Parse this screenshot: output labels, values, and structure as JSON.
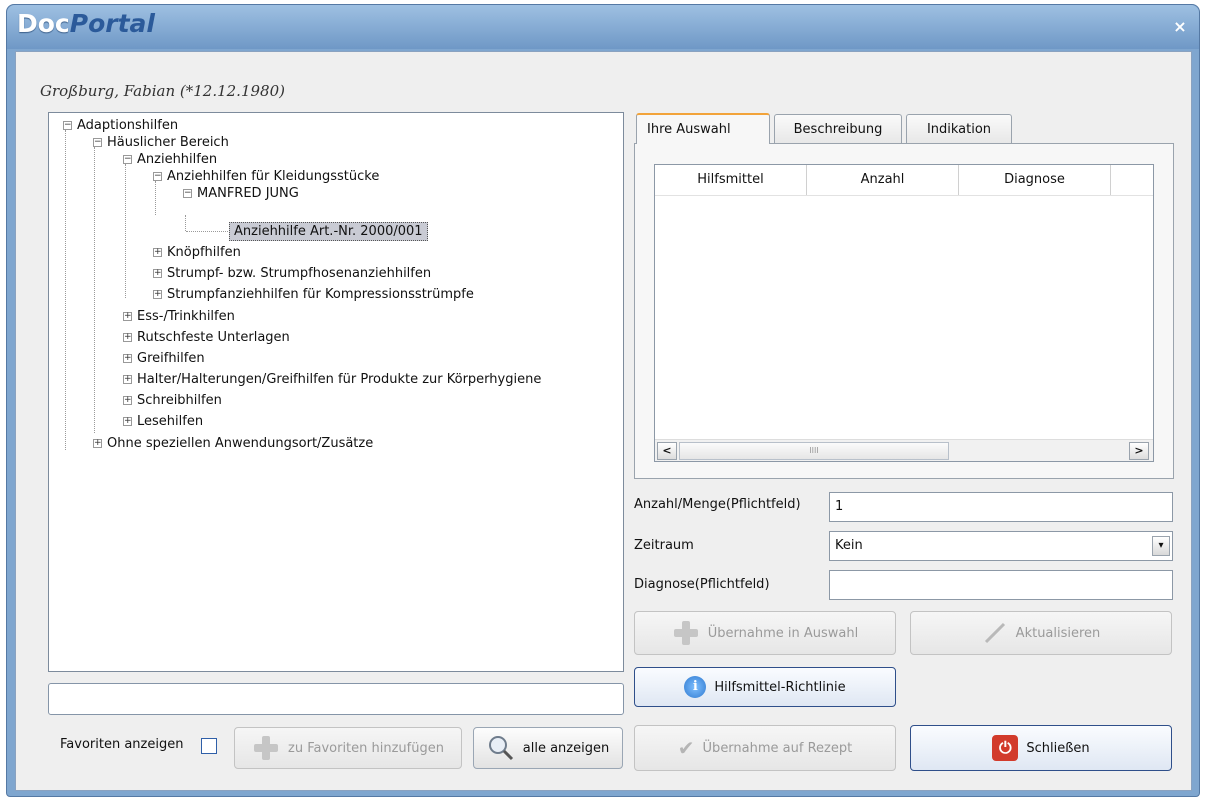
{
  "window": {
    "title_part1": "Doc",
    "title_part2": "Portal",
    "close_glyph": "×"
  },
  "patient": "Großburg, Fabian (*12.12.1980)",
  "tree": [
    {
      "label": "Adaptionshilfen",
      "toggle": "−"
    },
    {
      "label": "Häuslicher Bereich",
      "toggle": "−"
    },
    {
      "label": "Anziehhilfen",
      "toggle": "−"
    },
    {
      "label": "Anziehhilfen für Kleidungsstücke",
      "toggle": "−"
    },
    {
      "label": "MANFRED JUNG",
      "toggle": "−"
    },
    {
      "label": "Anziehhilfe Art.-Nr. 2000/001",
      "selected": true
    },
    {
      "label": "Knöpfhilfen",
      "toggle": "+"
    },
    {
      "label": "Strumpf- bzw. Strumpfhosenanziehhilfen",
      "toggle": "+"
    },
    {
      "label": "Strumpfanziehhilfen für Kompressionsstrümpfe",
      "toggle": "+"
    },
    {
      "label": "Ess-/Trinkhilfen",
      "toggle": "+"
    },
    {
      "label": "Rutschfeste Unterlagen",
      "toggle": "+"
    },
    {
      "label": "Greifhilfen",
      "toggle": "+"
    },
    {
      "label": "Halter/Halterungen/Greifhilfen für Produkte zur Körperhygiene",
      "toggle": "+"
    },
    {
      "label": "Schreibhilfen",
      "toggle": "+"
    },
    {
      "label": "Lesehilfen",
      "toggle": "+"
    },
    {
      "label": "Ohne speziellen Anwendungsort/Zusätze",
      "toggle": "+"
    }
  ],
  "tabs": [
    "Ihre Auswahl",
    "Beschreibung",
    "Indikation"
  ],
  "grid": {
    "columns": [
      "Hilfsmittel",
      "Anzahl",
      "Diagnose"
    ],
    "scroll_left": "<",
    "scroll_right": ">",
    "thumb_grip": "IIII"
  },
  "form": {
    "anzahl_label": "Anzahl/Menge(Pflichtfeld)",
    "anzahl_value": "1",
    "zeitraum_label": "Zeitraum",
    "zeitraum_value": "Kein",
    "zeitraum_arrow": "▾",
    "diagnose_label": "Diagnose(Pflichtfeld)",
    "diagnose_value": ""
  },
  "buttons": {
    "uebernahme_auswahl": "Übernahme in Auswahl",
    "aktualisieren": "Aktualisieren",
    "richtlinie": "Hilfsmittel-Richtlinie",
    "uebernahme_rezept": "Übernahme auf Rezept",
    "schliessen": "Schließen",
    "zu_favoriten": "zu Favoriten hinzufügen",
    "alle_anzeigen": "alle anzeigen"
  },
  "favorites": {
    "label": "Favoriten anzeigen",
    "checked": false
  },
  "icons": {
    "info": "i",
    "power": "⏻",
    "check": "✔",
    "pencil": "/"
  },
  "colors": {
    "tab_active_accent": "#f2a33a",
    "selection_bg": "#c9cbd4",
    "power_red": "#d23b2c",
    "info_blue": "#2f79d0"
  }
}
